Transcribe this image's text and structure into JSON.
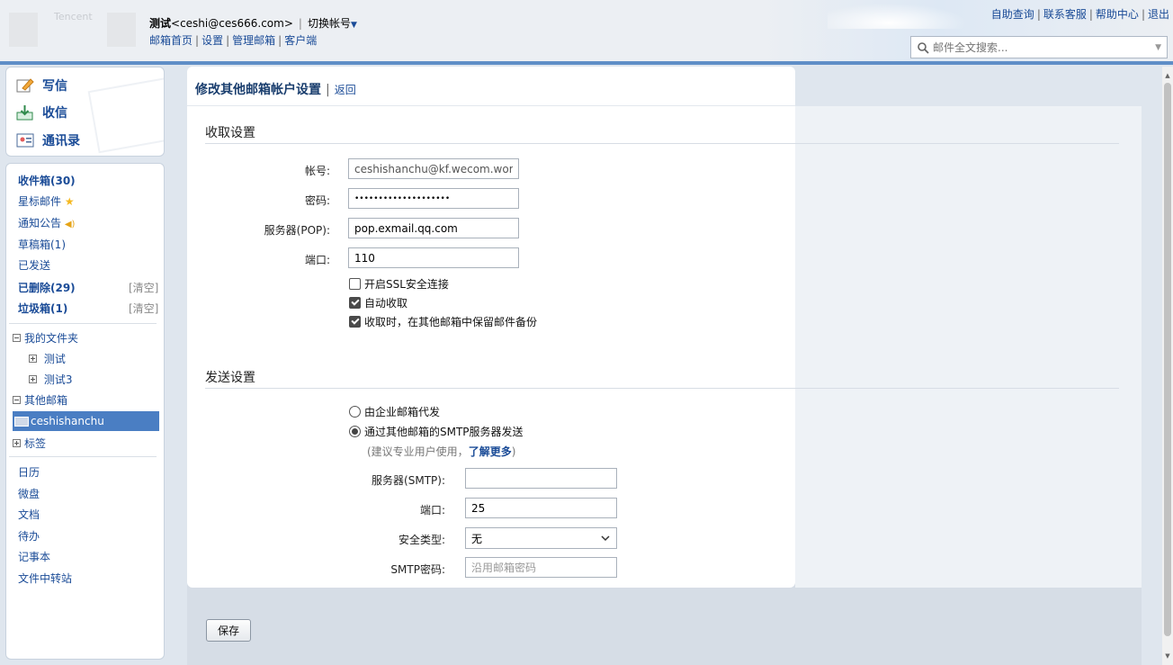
{
  "header": {
    "logo_text": "Tencent",
    "user_name": "测试",
    "user_email": "<ceshi@ces666.com>",
    "switch_account": "切换帐号",
    "nav": [
      "邮箱首页",
      "设置",
      "管理邮箱",
      "客户端"
    ],
    "top_links": [
      "自助查询",
      "联系客服",
      "帮助中心",
      "退出"
    ],
    "search_placeholder": "邮件全文搜索..."
  },
  "sidebar": {
    "compose": "写信",
    "receive": "收信",
    "contacts": "通讯录",
    "folders": [
      {
        "label": "收件箱(30)",
        "bold": true
      },
      {
        "label": "星标邮件",
        "bold": false
      },
      {
        "label": "通知公告",
        "bold": false
      },
      {
        "label": "草稿箱(1)",
        "bold": false
      },
      {
        "label": "已发送",
        "bold": false
      },
      {
        "label": "已删除(29)",
        "bold": true
      },
      {
        "label": "垃圾箱(1)",
        "bold": true
      }
    ],
    "clear_label": "[清空]",
    "my_folders": "我的文件夹",
    "my_folder_items": [
      "测试",
      "测试3"
    ],
    "other_mailboxes": "其他邮箱",
    "selected_mailbox": "ceshishanchu",
    "tags": "标签",
    "apps": [
      "日历",
      "微盘",
      "文档",
      "待办",
      "记事本",
      "文件中转站"
    ]
  },
  "content": {
    "title": "修改其他邮箱帐户设置",
    "back": "返回",
    "receive_section": "收取设置",
    "account_label": "帐号:",
    "account_value": "ceshishanchu@kf.wecom.work",
    "password_label": "密码:",
    "password_value": "••••••••••••••••••••",
    "pop_label": "服务器(POP):",
    "pop_value": "pop.exmail.qq.com",
    "port_label": "端口:",
    "port_value": "110",
    "ssl_label": "开启SSL安全连接",
    "auto_receive_label": "自动收取",
    "keep_backup_label": "收取时，在其他邮箱中保留邮件备份",
    "send_section": "发送设置",
    "send_option1": "由企业邮箱代发",
    "send_option2": "通过其他邮箱的SMTP服务器发送",
    "hint_prefix": "(建议专业用户使用，",
    "hint_link": "了解更多",
    "hint_suffix": ")",
    "smtp_label": "服务器(SMTP):",
    "smtp_value": "",
    "smtp_port_label": "端口:",
    "smtp_port_value": "25",
    "security_label": "安全类型:",
    "security_value": "无",
    "smtp_password_label": "SMTP密码:",
    "smtp_password_placeholder": "沿用邮箱密码",
    "save": "保存"
  },
  "colors": {
    "accent_blue": "#1a4b97",
    "selected_bg": "#4a7ec3",
    "header_bar": "#5f8ec7"
  }
}
